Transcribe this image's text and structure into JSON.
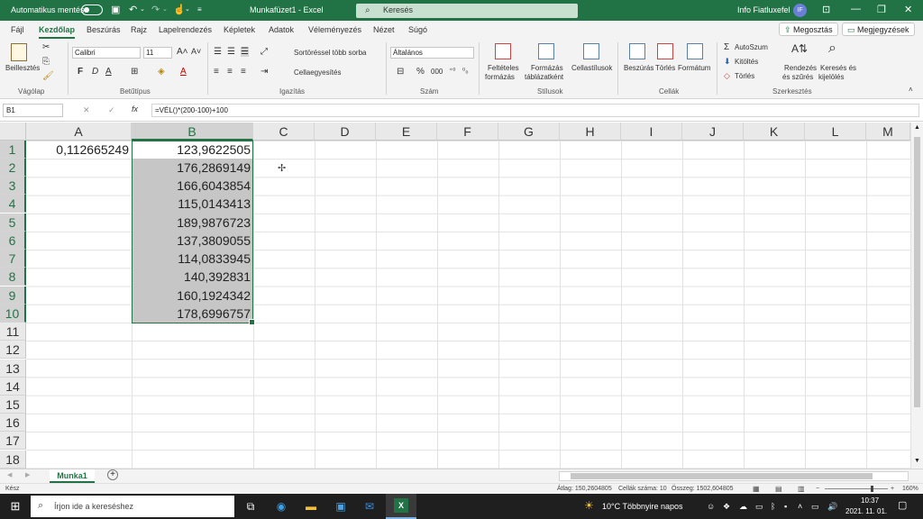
{
  "titlebar": {
    "autosave_label": "Automatikus mentés",
    "document_title": "Munkafüzet1  -  Excel",
    "search_placeholder": "Keresés",
    "user_name": "Info Fiatluxefel",
    "user_initials": "IF"
  },
  "menu": {
    "tabs": [
      "Fájl",
      "Kezdőlap",
      "Beszúrás",
      "Rajz",
      "Lapelrendezés",
      "Képletek",
      "Adatok",
      "Véleményezés",
      "Nézet",
      "Súgó"
    ],
    "active_tab": "Kezdőlap",
    "share_label": "Megosztás",
    "comments_label": "Megjegyzések"
  },
  "ribbon": {
    "groups": {
      "clipboard": "Vágólap",
      "font": "Betűtípus",
      "alignment": "Igazítás",
      "number": "Szám",
      "styles": "Stílusok",
      "cells": "Cellák",
      "editing": "Szerkesztés"
    },
    "paste_label": "Beillesztés",
    "font_name": "Calibri",
    "font_size": "11",
    "bold": "F",
    "italic": "D",
    "underline": "A",
    "wrap_text_label": "Sortöréssel több sorba",
    "merge_label": "Cellaegyesítés",
    "number_format": "Általános",
    "percent": "%",
    "thousands": "000",
    "conditional_format": [
      "Feltételes",
      "formázás"
    ],
    "format_as_table": [
      "Formázás",
      "táblázatként"
    ],
    "cell_styles": "Cellastílusok",
    "insert_label": "Beszúrás",
    "delete_label": "Törlés",
    "format_label": "Formátum",
    "autosum_label": "AutoSzum",
    "fill_label": "Kitöltés",
    "clear_label": "Törlés",
    "sort_filter": [
      "Rendezés",
      "és szűrés"
    ],
    "find_select": [
      "Keresés és",
      "kijelölés"
    ]
  },
  "formula_bar": {
    "name_box": "B1",
    "formula": "=VÉL()*(200-100)+100",
    "fx": "fx"
  },
  "grid": {
    "columns": [
      "A",
      "B",
      "C",
      "D",
      "E",
      "F",
      "G",
      "H",
      "I",
      "J",
      "K",
      "L",
      "M"
    ],
    "rows": [
      "1",
      "2",
      "3",
      "4",
      "5",
      "6",
      "7",
      "8",
      "9",
      "10",
      "11",
      "12",
      "13",
      "14",
      "15",
      "16",
      "17",
      "18"
    ],
    "selected_column": "B",
    "cells_a": [
      "0,112665249"
    ],
    "cells_b": [
      "123,9622505",
      "176,2869149",
      "166,6043854",
      "115,0143413",
      "189,9876723",
      "137,3809055",
      "114,0833945",
      "140,392831",
      "160,1924342",
      "178,6996757"
    ]
  },
  "sheets": {
    "tabs": [
      "Munka1"
    ],
    "add_label": "+"
  },
  "status": {
    "ready": "Kész",
    "average": "Átlag: 150,2604805",
    "count": "Cellák száma: 10",
    "sum": "Összeg: 1502,604805",
    "zoom": "160%"
  },
  "taskbar": {
    "search_placeholder": "Írjon ide a kereséshez",
    "weather": "10°C  Többnyire napos",
    "time": "10:37",
    "date": "2021. 11. 01."
  }
}
